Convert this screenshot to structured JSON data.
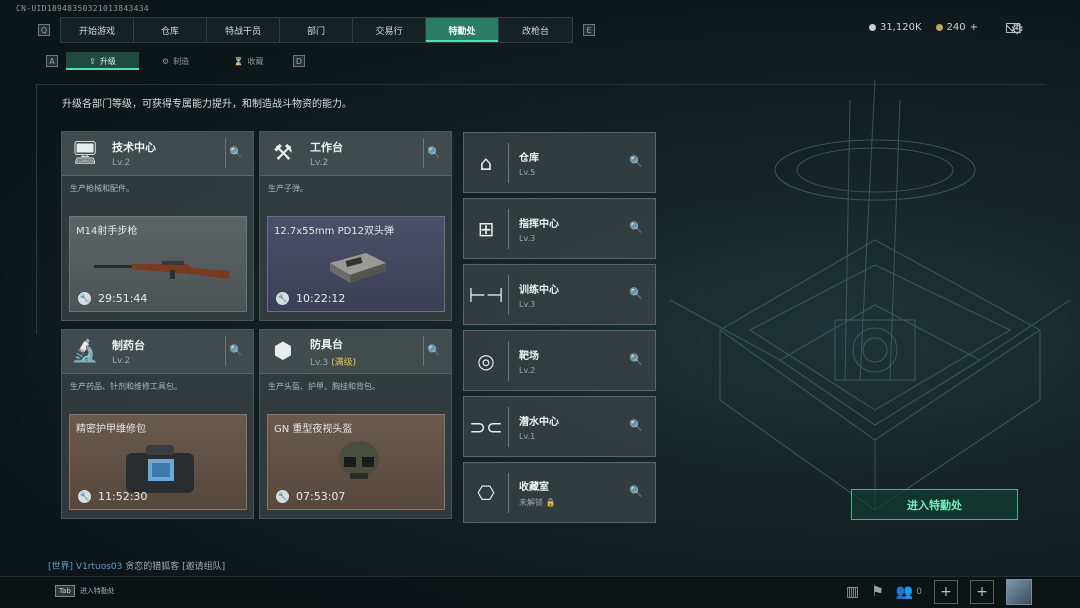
{
  "uid": "CN-UID18948350321013843434",
  "nav": {
    "left_key": "Q",
    "right_key": "E",
    "tabs": [
      "开始游戏",
      "仓库",
      "特战干员",
      "部门",
      "交易行",
      "特勤处",
      "改枪台"
    ],
    "active": "特勤处"
  },
  "subnav": {
    "left_key": "A",
    "right_key": "D",
    "tabs": [
      {
        "label": "升级",
        "icon": "upgrade-icon"
      },
      {
        "label": "制造",
        "icon": "craft-icon"
      },
      {
        "label": "收藏",
        "icon": "collection-icon"
      }
    ],
    "active": "升级"
  },
  "currency": {
    "silver": "31,120K",
    "gold": "240"
  },
  "description": "升级各部门等级，可获得专属能力提升，和制造战斗物资的能力。",
  "workshops": [
    {
      "name": "技术中心",
      "level": "Lv.2",
      "desc": "生产枪械和配件。",
      "item": "M14射手步枪",
      "timer": "29:51:44",
      "icon": "monitor-icon"
    },
    {
      "name": "工作台",
      "level": "Lv.2",
      "desc": "生产子弹。",
      "item": "12.7x55mm PD12双头弹",
      "timer": "10:22:12",
      "icon": "tools-icon"
    },
    {
      "name": "制药台",
      "level": "Lv.2",
      "desc": "生产药品、针剂和维修工具包。",
      "item": "精密护甲维修包",
      "timer": "11:52:30",
      "icon": "microscope-icon"
    },
    {
      "name": "防具台",
      "level": "Lv.3",
      "level_note": "(满级)",
      "desc": "生产头盔、护甲、胸挂和背包。",
      "item": "GN 重型夜视头盔",
      "timer": "07:53:07",
      "icon": "armor-icon"
    }
  ],
  "facilities": [
    {
      "name": "仓库",
      "level": "Lv.5",
      "icon": "warehouse-icon"
    },
    {
      "name": "指挥中心",
      "level": "Lv.3",
      "icon": "chip-icon"
    },
    {
      "name": "训练中心",
      "level": "Lv.3",
      "icon": "dumbbell-icon"
    },
    {
      "name": "靶场",
      "level": "Lv.2",
      "icon": "target-icon"
    },
    {
      "name": "潜水中心",
      "level": "Lv.1",
      "icon": "diving-mask-icon"
    },
    {
      "name": "收藏室",
      "level": "未解锁",
      "icon": "vault-icon",
      "locked": true
    }
  ],
  "enter_button": "进入特勤处",
  "chat": {
    "channel": "[世界]",
    "user": "V1rtuos03",
    "message": "贪恋的猎狐客 [邀请组队]"
  },
  "tab_hint": {
    "key": "Tab",
    "label": "进入特勤处"
  },
  "friends_count": "0"
}
